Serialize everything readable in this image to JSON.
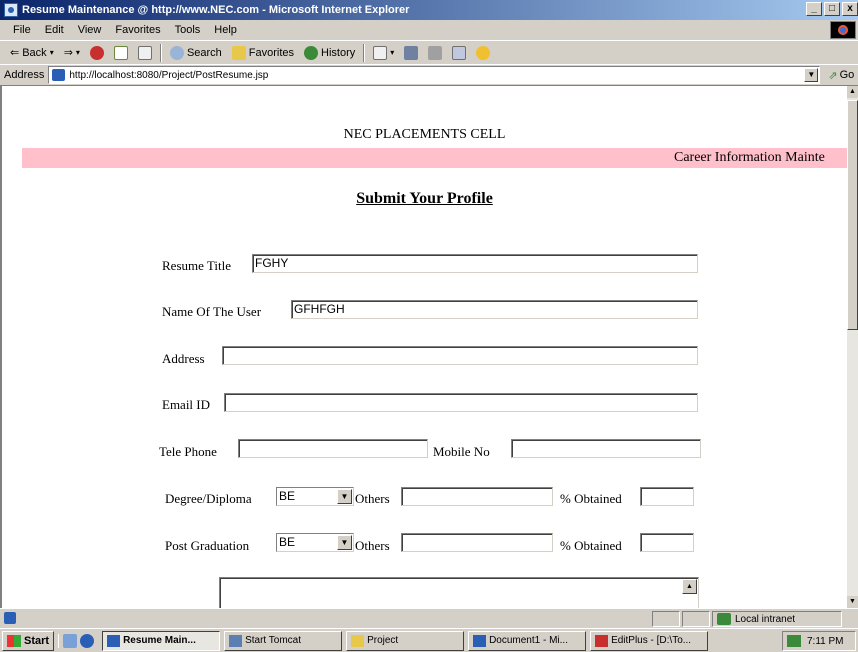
{
  "window": {
    "title": "Resume Maintenance @ http://www.NEC.com - Microsoft Internet Explorer",
    "minimize": "_",
    "maximize": "□",
    "close": "x"
  },
  "menu": [
    "File",
    "Edit",
    "View",
    "Favorites",
    "Tools",
    "Help"
  ],
  "toolbar": {
    "back": "Back",
    "search": "Search",
    "favorites": "Favorites",
    "history": "History"
  },
  "address": {
    "label": "Address",
    "url": "http://localhost:8080/Project/PostResume.jsp",
    "go": "Go"
  },
  "page": {
    "header": "NEC PLACEMENTS CELL",
    "marquee": "Career Information Mainte",
    "form_title": "Submit Your Profile",
    "fields": {
      "resume_title": {
        "label": "Resume Title",
        "value": "FGHY"
      },
      "user_name": {
        "label": "Name Of The User",
        "value": "GFHFGH"
      },
      "address": {
        "label": "Address",
        "value": ""
      },
      "email": {
        "label": "Email ID",
        "value": ""
      },
      "telephone": {
        "label": "Tele Phone",
        "value": ""
      },
      "mobile": {
        "label": "Mobile No",
        "value": ""
      },
      "degree": {
        "label": "Degree/Diploma",
        "value": "BE"
      },
      "degree_others": {
        "label": "Others",
        "value": ""
      },
      "degree_percent": {
        "label": "% Obtained",
        "value": ""
      },
      "pg": {
        "label": "Post Graduation",
        "value": "BE"
      },
      "pg_others": {
        "label": "Others",
        "value": ""
      },
      "pg_percent": {
        "label": "% Obtained",
        "value": ""
      }
    }
  },
  "status": {
    "zone": "Local intranet"
  },
  "taskbar": {
    "start": "Start",
    "tasks": [
      {
        "label": "Resume Main...",
        "active": true,
        "color": "#2a5fb5"
      },
      {
        "label": "Start Tomcat",
        "active": false,
        "color": "#5a7fb0"
      },
      {
        "label": "Project",
        "active": false,
        "color": "#e8c84a"
      },
      {
        "label": "Document1 - Mi...",
        "active": false,
        "color": "#2a5fb5"
      },
      {
        "label": "EditPlus - [D:\\To...",
        "active": false,
        "color": "#c83030"
      }
    ],
    "clock": "7:11 PM"
  }
}
